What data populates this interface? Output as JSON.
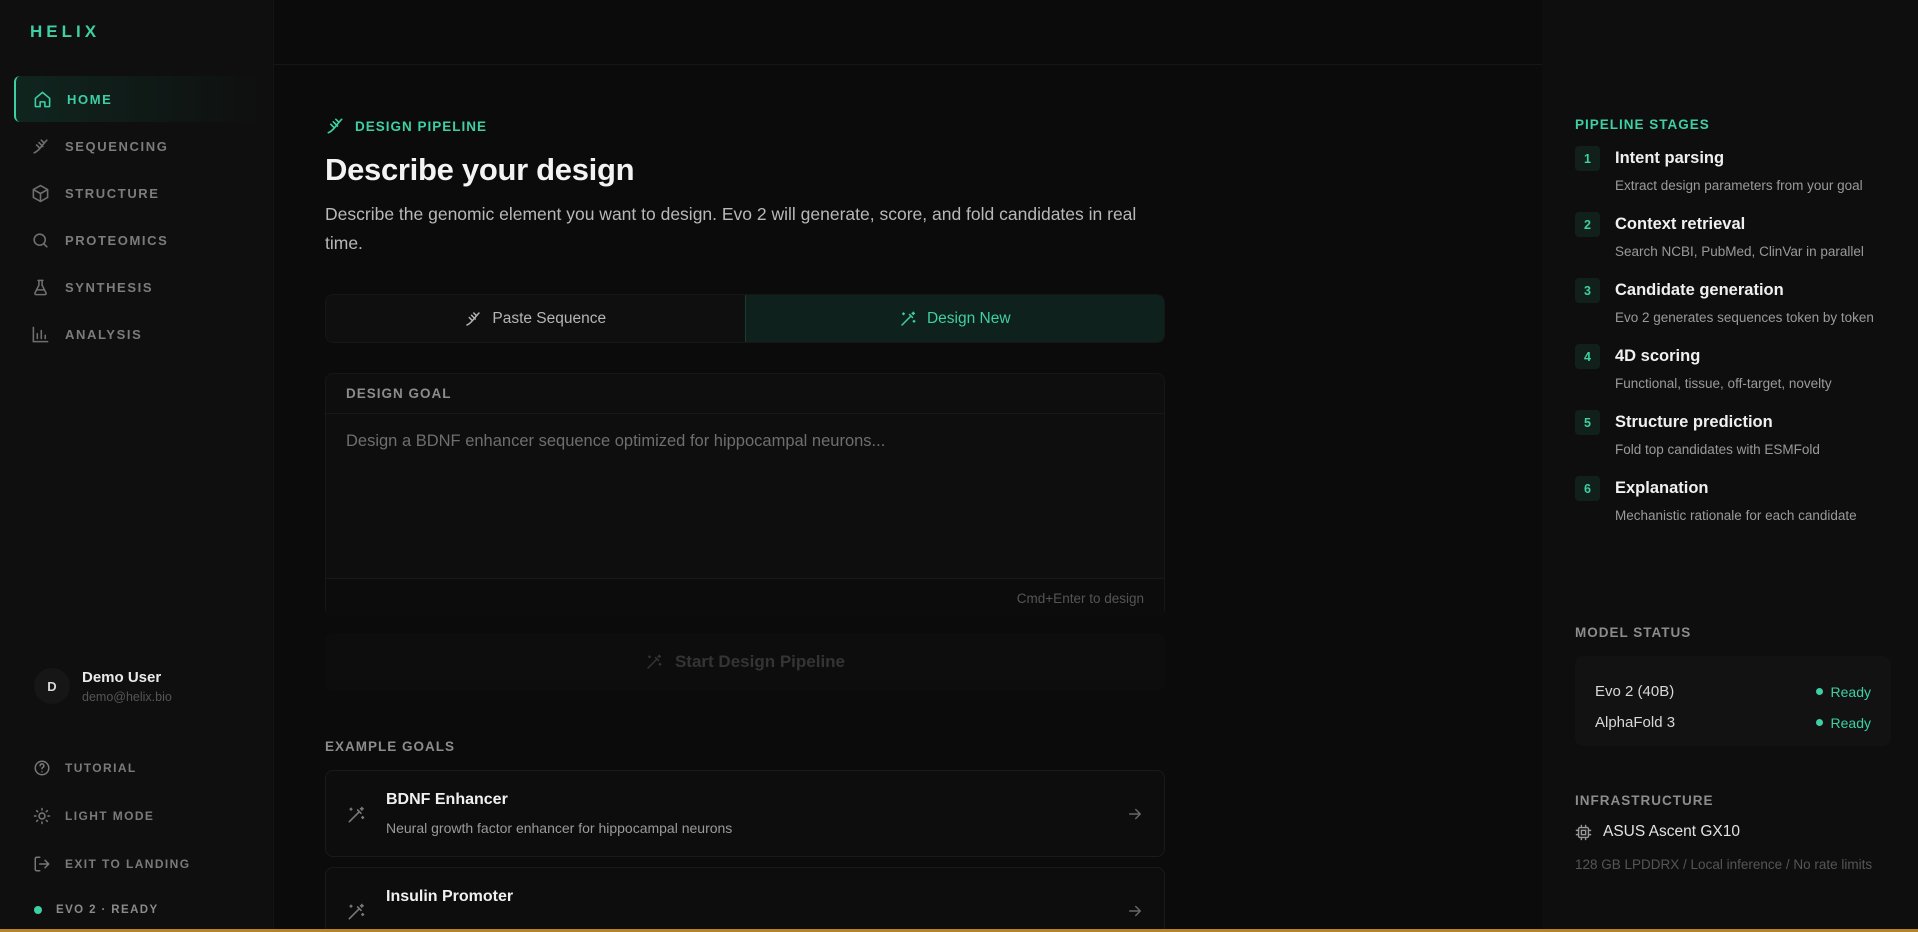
{
  "app": {
    "logo": "HELIX"
  },
  "sidebar": {
    "items": [
      {
        "label": "HOME",
        "icon": "home-icon",
        "active": true
      },
      {
        "label": "SEQUENCING",
        "icon": "dna-icon"
      },
      {
        "label": "STRUCTURE",
        "icon": "cube-icon"
      },
      {
        "label": "PROTEOMICS",
        "icon": "search-icon"
      },
      {
        "label": "SYNTHESIS",
        "icon": "flask-icon"
      },
      {
        "label": "ANALYSIS",
        "icon": "bar-chart-icon"
      }
    ],
    "user": {
      "initial": "D",
      "name": "Demo User",
      "email": "demo@helix.bio"
    },
    "bottom": [
      {
        "label": "TUTORIAL",
        "icon": "help-circle-icon"
      },
      {
        "label": "LIGHT MODE",
        "icon": "sun-icon"
      },
      {
        "label": "EXIT TO LANDING",
        "icon": "logout-icon"
      }
    ],
    "status": "EVO 2 · READY"
  },
  "main": {
    "eyebrow": "DESIGN PIPELINE",
    "title": "Describe your design",
    "description": "Describe the genomic element you want to design. Evo 2 will generate, score, and fold candidates in real time.",
    "tabs": [
      {
        "label": "Paste Sequence",
        "icon": "dna-icon",
        "active": false
      },
      {
        "label": "Design New",
        "icon": "magic-wand-icon",
        "active": true
      }
    ],
    "goal": {
      "label": "DESIGN GOAL",
      "placeholder": "Design a BDNF enhancer sequence optimized for hippocampal neurons...",
      "value": "",
      "hint": "Cmd+Enter to design"
    },
    "start_button": "Start Design Pipeline",
    "examples_title": "EXAMPLE GOALS",
    "examples": [
      {
        "title": "BDNF Enhancer",
        "subtitle": "Neural growth factor enhancer for hippocampal neurons"
      },
      {
        "title": "Insulin Promoter",
        "subtitle": ""
      }
    ]
  },
  "right": {
    "stages_title": "PIPELINE STAGES",
    "stages": [
      {
        "num": "1",
        "title": "Intent parsing",
        "desc": "Extract design parameters from your goal"
      },
      {
        "num": "2",
        "title": "Context retrieval",
        "desc": "Search NCBI, PubMed, ClinVar in parallel"
      },
      {
        "num": "3",
        "title": "Candidate generation",
        "desc": "Evo 2 generates sequences token by token"
      },
      {
        "num": "4",
        "title": "4D scoring",
        "desc": "Functional, tissue, off-target, novelty"
      },
      {
        "num": "5",
        "title": "Structure prediction",
        "desc": "Fold top candidates with ESMFold"
      },
      {
        "num": "6",
        "title": "Explanation",
        "desc": "Mechanistic rationale for each candidate"
      }
    ],
    "model_status_title": "MODEL STATUS",
    "models": [
      {
        "name": "Evo 2 (40B)",
        "status": "Ready"
      },
      {
        "name": "AlphaFold 3",
        "status": "Ready"
      }
    ],
    "infra_title": "INFRASTRUCTURE",
    "infra_name": "ASUS Ascent GX10",
    "infra_sub": "128 GB LPDDRX / Local inference / No rate limits"
  },
  "colors": {
    "accent": "#3ecfa3",
    "background": "#0b0b0b",
    "bottom_bar": "#b7832a"
  }
}
